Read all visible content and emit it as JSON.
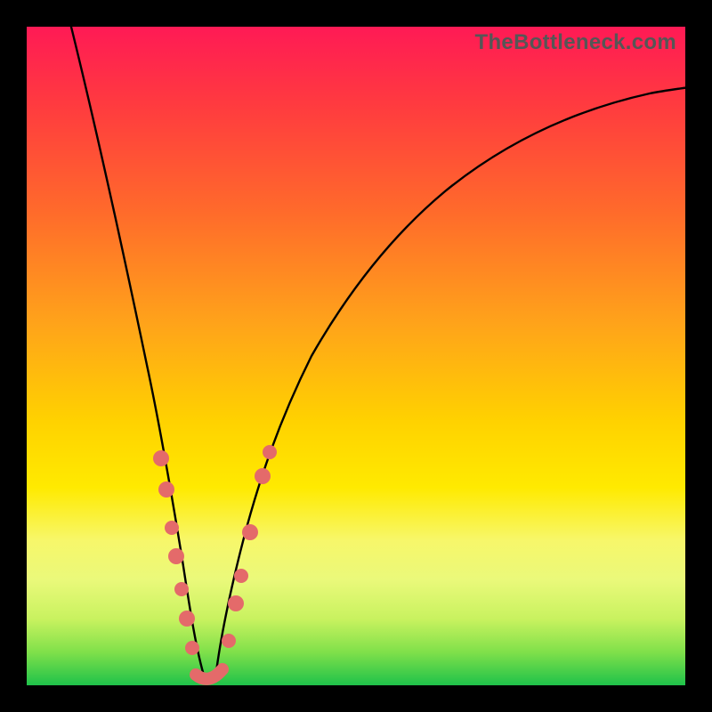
{
  "watermark": "TheBottleneck.com",
  "colors": {
    "gradient_top": "#ff1a55",
    "gradient_mid": "#ffd200",
    "gradient_bottom": "#1fc24a",
    "frame": "#000000",
    "curve": "#000000",
    "dots": "#e46a6a"
  },
  "chart_data": {
    "type": "line",
    "title": "",
    "xlabel": "",
    "ylabel": "",
    "xlim": [
      0,
      100
    ],
    "ylim": [
      0,
      100
    ],
    "grid": false,
    "note": "Approximate V-shaped bottleneck curve. y is percent (higher = worse / redder). Minimum near x≈25.",
    "series": [
      {
        "name": "bottleneck-curve",
        "x": [
          0,
          5,
          10,
          14,
          17,
          20,
          22,
          24,
          26,
          28,
          30,
          32,
          35,
          40,
          46,
          52,
          60,
          70,
          80,
          90,
          100
        ],
        "values": [
          100,
          90,
          77,
          62,
          47,
          32,
          18,
          5,
          0,
          2,
          9,
          18,
          30,
          45,
          56,
          64,
          71,
          75,
          78,
          80,
          81
        ]
      }
    ],
    "markers": {
      "name": "highlight-dots",
      "note": "Pink dots near the valley; approximate readings off image.",
      "points": [
        {
          "x": 17,
          "y": 38
        },
        {
          "x": 18,
          "y": 33
        },
        {
          "x": 19.5,
          "y": 26
        },
        {
          "x": 20.5,
          "y": 21
        },
        {
          "x": 21.5,
          "y": 15
        },
        {
          "x": 22.5,
          "y": 10
        },
        {
          "x": 23.5,
          "y": 5
        },
        {
          "x": 25,
          "y": 1
        },
        {
          "x": 27,
          "y": 1
        },
        {
          "x": 28.5,
          "y": 4
        },
        {
          "x": 30,
          "y": 11
        },
        {
          "x": 30.5,
          "y": 16
        },
        {
          "x": 32,
          "y": 23
        },
        {
          "x": 34,
          "y": 33
        },
        {
          "x": 35,
          "y": 37
        }
      ]
    }
  }
}
